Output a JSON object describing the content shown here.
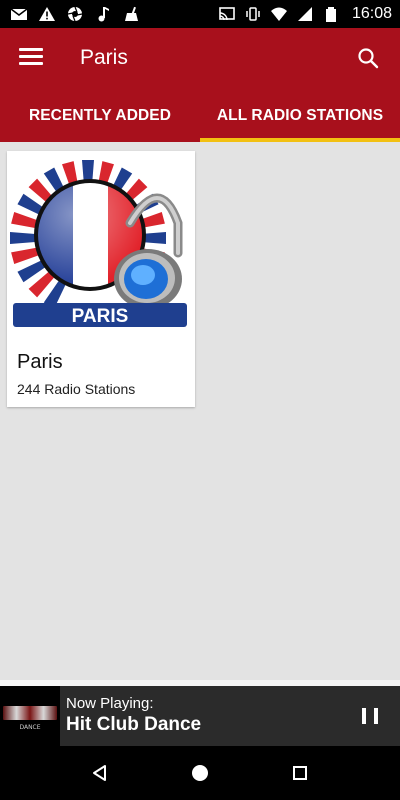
{
  "status_bar": {
    "time": "16:08",
    "left_icons": [
      "mail-icon",
      "alert-icon",
      "aperture-icon",
      "music-note-icon",
      "cleaner-icon"
    ],
    "right_icons": [
      "cast-icon",
      "vibrate-icon",
      "wifi-icon",
      "signal-icon",
      "battery-icon"
    ]
  },
  "app_bar": {
    "title": "Paris",
    "color": "#a8101c"
  },
  "tabs": [
    {
      "label": "RECENTLY ADDED",
      "active": false
    },
    {
      "label": "ALL RADIO STATIONS",
      "active": true
    }
  ],
  "tab_indicator_color": "#f2c012",
  "cards": [
    {
      "title": "Paris",
      "subtitle": "244 Radio Stations",
      "image_label": "PARIS"
    }
  ],
  "player": {
    "now_playing_label": "Now Playing:",
    "track_title": "Hit Club Dance",
    "art_caption": "DANCE"
  }
}
